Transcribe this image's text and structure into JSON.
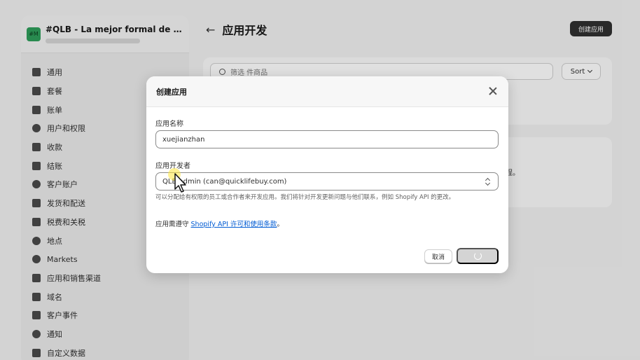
{
  "sidebar": {
    "store_avatar": "#M",
    "store_name": "#QLB - La mejor formal de com...",
    "items": [
      {
        "label": "通用",
        "icon": "store-icon"
      },
      {
        "label": "套餐",
        "icon": "chart-icon"
      },
      {
        "label": "账单",
        "icon": "billing-icon"
      },
      {
        "label": "用户和权限",
        "icon": "users-icon"
      },
      {
        "label": "收款",
        "icon": "payments-icon"
      },
      {
        "label": "结账",
        "icon": "cart-icon"
      },
      {
        "label": "客户账户",
        "icon": "person-icon"
      },
      {
        "label": "发货和配送",
        "icon": "truck-icon"
      },
      {
        "label": "税费和关税",
        "icon": "tax-icon"
      },
      {
        "label": "地点",
        "icon": "location-icon"
      },
      {
        "label": "Markets",
        "icon": "globe-icon"
      },
      {
        "label": "应用和销售渠道",
        "icon": "apps-icon"
      },
      {
        "label": "域名",
        "icon": "domain-icon"
      },
      {
        "label": "客户事件",
        "icon": "events-icon"
      },
      {
        "label": "通知",
        "icon": "bell-icon"
      },
      {
        "label": "自定义数据",
        "icon": "data-icon"
      }
    ]
  },
  "header": {
    "title": "应用开发",
    "create_button": "创建应用"
  },
  "filter": {
    "search_placeholder": "筛选 件商品",
    "sort_label": "Sort"
  },
  "list": {
    "snippet": "程。"
  },
  "modal": {
    "title": "创建应用",
    "name_label": "应用名称",
    "name_value": "xuejianzhan",
    "developer_label": "应用开发者",
    "developer_value": "QLB admin (can@quicklifebuy.com)",
    "help_text": "可以分配给有权限的员工或合作者来开发应用。我们将针对开发更新问题与他们联系，例如 Shopify API 的更改。",
    "terms_prefix": "应用需遵守 ",
    "terms_link": "Shopify API 许可和使用条款",
    "terms_suffix": "。",
    "cancel_label": "取消"
  }
}
